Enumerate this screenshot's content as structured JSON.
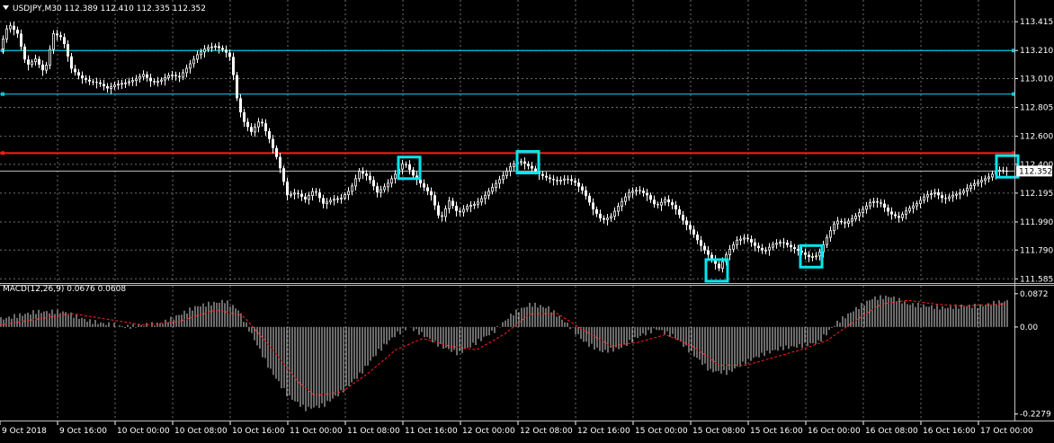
{
  "chart_data": [
    {
      "type": "candlestick",
      "title": "USDJPY,M30  112.389 112.410 112.335 112.352",
      "symbol": "USDJPY",
      "timeframe": "M30",
      "ohlc_label": "112.389 112.410 112.335 112.352",
      "y_ticks": [
        113.415,
        113.21,
        113.01,
        112.805,
        112.6,
        112.4,
        112.195,
        111.99,
        111.79,
        111.585
      ],
      "ylim": [
        111.555,
        113.48
      ],
      "current_price": 112.352,
      "horizontal_lines": [
        {
          "value": 113.21,
          "color": "#00c8d8"
        },
        {
          "value": 112.9,
          "color": "#00c8d8"
        },
        {
          "value": 112.48,
          "color": "#ff1a1a"
        }
      ],
      "x_ticks": [
        "9 Oct 2018",
        "9 Oct 16:00",
        "10 Oct 00:00",
        "10 Oct 08:00",
        "10 Oct 16:00",
        "11 Oct 00:00",
        "11 Oct 08:00",
        "11 Oct 16:00",
        "12 Oct 00:00",
        "12 Oct 08:00",
        "12 Oct 16:00",
        "15 Oct 00:00",
        "15 Oct 08:00",
        "15 Oct 16:00",
        "16 Oct 00:00",
        "16 Oct 08:00",
        "16 Oct 16:00",
        "17 Oct 00:00"
      ],
      "price_path": [
        [
          0,
          113.22
        ],
        [
          10,
          113.4
        ],
        [
          20,
          113.33
        ],
        [
          30,
          113.1
        ],
        [
          40,
          113.15
        ],
        [
          50,
          113.05
        ],
        [
          60,
          113.33
        ],
        [
          70,
          113.3
        ],
        [
          80,
          113.08
        ],
        [
          90,
          113.02
        ],
        [
          100,
          112.99
        ],
        [
          110,
          112.98
        ],
        [
          120,
          112.94
        ],
        [
          130,
          112.97
        ],
        [
          140,
          112.98
        ],
        [
          150,
          113.0
        ],
        [
          160,
          113.04
        ],
        [
          170,
          112.98
        ],
        [
          180,
          113.0
        ],
        [
          190,
          113.04
        ],
        [
          200,
          113.02
        ],
        [
          210,
          113.1
        ],
        [
          220,
          113.18
        ],
        [
          230,
          113.23
        ],
        [
          240,
          113.24
        ],
        [
          250,
          113.21
        ],
        [
          258,
          113.15
        ],
        [
          262,
          112.92
        ],
        [
          270,
          112.72
        ],
        [
          280,
          112.63
        ],
        [
          290,
          112.72
        ],
        [
          300,
          112.58
        ],
        [
          310,
          112.42
        ],
        [
          320,
          112.18
        ],
        [
          330,
          112.2
        ],
        [
          340,
          112.15
        ],
        [
          350,
          112.22
        ],
        [
          360,
          112.12
        ],
        [
          370,
          112.15
        ],
        [
          380,
          112.16
        ],
        [
          390,
          112.22
        ],
        [
          400,
          112.35
        ],
        [
          410,
          112.31
        ],
        [
          420,
          112.2
        ],
        [
          430,
          112.25
        ],
        [
          440,
          112.33
        ],
        [
          450,
          112.42
        ],
        [
          460,
          112.32
        ],
        [
          470,
          112.25
        ],
        [
          480,
          112.18
        ],
        [
          490,
          112.0
        ],
        [
          500,
          112.14
        ],
        [
          510,
          112.05
        ],
        [
          520,
          112.1
        ],
        [
          530,
          112.12
        ],
        [
          540,
          112.18
        ],
        [
          550,
          112.25
        ],
        [
          560,
          112.32
        ],
        [
          570,
          112.4
        ],
        [
          580,
          112.42
        ],
        [
          590,
          112.38
        ],
        [
          600,
          112.33
        ],
        [
          610,
          112.3
        ],
        [
          620,
          112.28
        ],
        [
          630,
          112.3
        ],
        [
          640,
          112.27
        ],
        [
          650,
          112.2
        ],
        [
          660,
          112.08
        ],
        [
          670,
          112.0
        ],
        [
          680,
          112.03
        ],
        [
          690,
          112.12
        ],
        [
          700,
          112.2
        ],
        [
          710,
          112.22
        ],
        [
          720,
          112.18
        ],
        [
          730,
          112.1
        ],
        [
          740,
          112.15
        ],
        [
          750,
          112.1
        ],
        [
          760,
          112.0
        ],
        [
          770,
          111.92
        ],
        [
          780,
          111.82
        ],
        [
          790,
          111.74
        ],
        [
          800,
          111.66
        ],
        [
          810,
          111.78
        ],
        [
          820,
          111.86
        ],
        [
          830,
          111.88
        ],
        [
          840,
          111.82
        ],
        [
          850,
          111.78
        ],
        [
          860,
          111.83
        ],
        [
          870,
          111.85
        ],
        [
          880,
          111.81
        ],
        [
          890,
          111.78
        ],
        [
          900,
          111.74
        ],
        [
          910,
          111.75
        ],
        [
          920,
          111.88
        ],
        [
          930,
          112.0
        ],
        [
          940,
          111.98
        ],
        [
          950,
          112.02
        ],
        [
          960,
          112.08
        ],
        [
          970,
          112.14
        ],
        [
          980,
          112.12
        ],
        [
          990,
          112.05
        ],
        [
          1000,
          112.02
        ],
        [
          1010,
          112.08
        ],
        [
          1020,
          112.12
        ],
        [
          1030,
          112.18
        ],
        [
          1040,
          112.2
        ],
        [
          1050,
          112.15
        ],
        [
          1060,
          112.18
        ],
        [
          1070,
          112.2
        ],
        [
          1080,
          112.25
        ],
        [
          1090,
          112.28
        ],
        [
          1100,
          112.31
        ],
        [
          1110,
          112.36
        ],
        [
          1118,
          112.352
        ]
      ],
      "markers": [
        {
          "x": 455,
          "price": 112.375
        },
        {
          "x": 587,
          "price": 112.415
        },
        {
          "x": 797,
          "price": 111.645
        },
        {
          "x": 902,
          "price": 111.745
        },
        {
          "x": 1120,
          "price": 112.385
        }
      ]
    },
    {
      "type": "histogram",
      "title": "MACD(12,26,9) 0.0676 0.0608",
      "indicator_label": "MACD(12,26,9) 0.0676 0.0608",
      "y_ticks": [
        0.0872,
        0.0,
        -0.2279
      ],
      "ylim": [
        -0.245,
        0.108
      ],
      "macd_path": [
        [
          0,
          0.02
        ],
        [
          40,
          0.04
        ],
        [
          70,
          0.04
        ],
        [
          100,
          0.015
        ],
        [
          140,
          0.0
        ],
        [
          180,
          0.01
        ],
        [
          220,
          0.055
        ],
        [
          250,
          0.068
        ],
        [
          265,
          0.045
        ],
        [
          280,
          -0.02
        ],
        [
          300,
          -0.11
        ],
        [
          320,
          -0.18
        ],
        [
          340,
          -0.215
        ],
        [
          360,
          -0.205
        ],
        [
          380,
          -0.17
        ],
        [
          400,
          -0.125
        ],
        [
          420,
          -0.065
        ],
        [
          440,
          -0.02
        ],
        [
          455,
          0.0
        ],
        [
          470,
          -0.02
        ],
        [
          490,
          -0.05
        ],
        [
          510,
          -0.07
        ],
        [
          530,
          -0.04
        ],
        [
          550,
          -0.01
        ],
        [
          570,
          0.035
        ],
        [
          590,
          0.06
        ],
        [
          610,
          0.05
        ],
        [
          630,
          0.01
        ],
        [
          650,
          -0.04
        ],
        [
          670,
          -0.065
        ],
        [
          690,
          -0.055
        ],
        [
          710,
          -0.025
        ],
        [
          730,
          -0.005
        ],
        [
          750,
          -0.025
        ],
        [
          770,
          -0.07
        ],
        [
          790,
          -0.115
        ],
        [
          810,
          -0.12
        ],
        [
          830,
          -0.09
        ],
        [
          850,
          -0.07
        ],
        [
          870,
          -0.055
        ],
        [
          890,
          -0.05
        ],
        [
          910,
          -0.04
        ],
        [
          930,
          0.01
        ],
        [
          950,
          0.045
        ],
        [
          970,
          0.075
        ],
        [
          990,
          0.08
        ],
        [
          1010,
          0.06
        ],
        [
          1030,
          0.055
        ],
        [
          1050,
          0.05
        ],
        [
          1070,
          0.055
        ],
        [
          1090,
          0.055
        ],
        [
          1110,
          0.065
        ],
        [
          1120,
          0.068
        ]
      ],
      "signal_path": [
        [
          0,
          0.005
        ],
        [
          40,
          0.02
        ],
        [
          80,
          0.035
        ],
        [
          120,
          0.02
        ],
        [
          160,
          0.005
        ],
        [
          200,
          0.015
        ],
        [
          240,
          0.045
        ],
        [
          270,
          0.03
        ],
        [
          300,
          -0.05
        ],
        [
          330,
          -0.14
        ],
        [
          350,
          -0.18
        ],
        [
          380,
          -0.17
        ],
        [
          410,
          -0.12
        ],
        [
          440,
          -0.06
        ],
        [
          470,
          -0.03
        ],
        [
          500,
          -0.05
        ],
        [
          530,
          -0.06
        ],
        [
          560,
          -0.02
        ],
        [
          590,
          0.035
        ],
        [
          620,
          0.035
        ],
        [
          650,
          -0.01
        ],
        [
          680,
          -0.05
        ],
        [
          710,
          -0.04
        ],
        [
          740,
          -0.02
        ],
        [
          770,
          -0.05
        ],
        [
          800,
          -0.1
        ],
        [
          830,
          -0.1
        ],
        [
          860,
          -0.08
        ],
        [
          890,
          -0.06
        ],
        [
          920,
          -0.035
        ],
        [
          950,
          0.015
        ],
        [
          980,
          0.06
        ],
        [
          1010,
          0.07
        ],
        [
          1040,
          0.06
        ],
        [
          1070,
          0.055
        ],
        [
          1100,
          0.058
        ],
        [
          1120,
          0.061
        ]
      ]
    }
  ]
}
